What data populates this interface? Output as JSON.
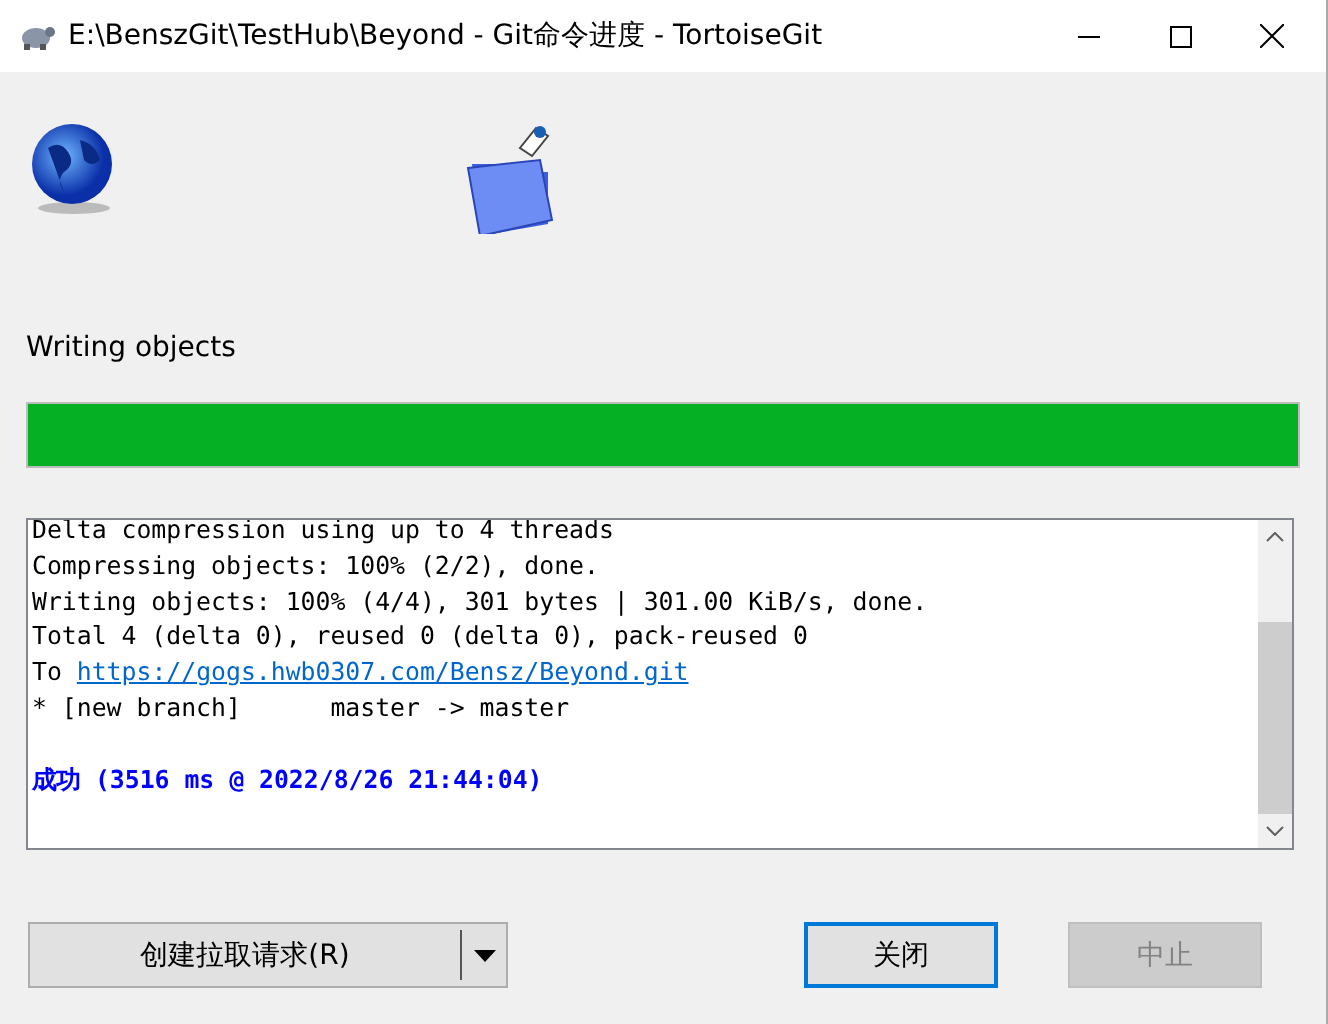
{
  "window": {
    "title": "E:\\BenszGit\\TestHub\\Beyond - Git命令进度 - TortoiseGit"
  },
  "status": {
    "label": "Writing objects",
    "level": 1
  },
  "log": [
    {
      "kind": "text",
      "text": "Delta compression using up to 4 threads"
    },
    {
      "kind": "text",
      "text": "Compressing objects: 100% (2/2), done."
    },
    {
      "kind": "text",
      "text": "Writing objects: 100% (4/4), 301 bytes | 301.00 KiB/s, done."
    },
    {
      "kind": "text",
      "text": "Total 4 (delta 0), reused 0 (delta 0), pack-reused 0"
    },
    {
      "kind": "link",
      "prefix": "To",
      "url": "https://gogs.hwb0307.com/Bensz/Beyond.git"
    },
    {
      "kind": "text",
      "text": "* [new branch]      master -> master"
    },
    {
      "kind": "blank"
    },
    {
      "kind": "success",
      "text": "成功 (3516 ms @ 2022/8/26 21:44:04)"
    }
  ],
  "buttons": [
    {
      "kind": "split",
      "label": "创建拉取请求(R)",
      "default": false,
      "disabled": false
    },
    {
      "kind": "push",
      "label": "关闭",
      "default": true,
      "disabled": false
    },
    {
      "kind": "push",
      "label": "中止",
      "default": false,
      "disabled": true
    }
  ]
}
